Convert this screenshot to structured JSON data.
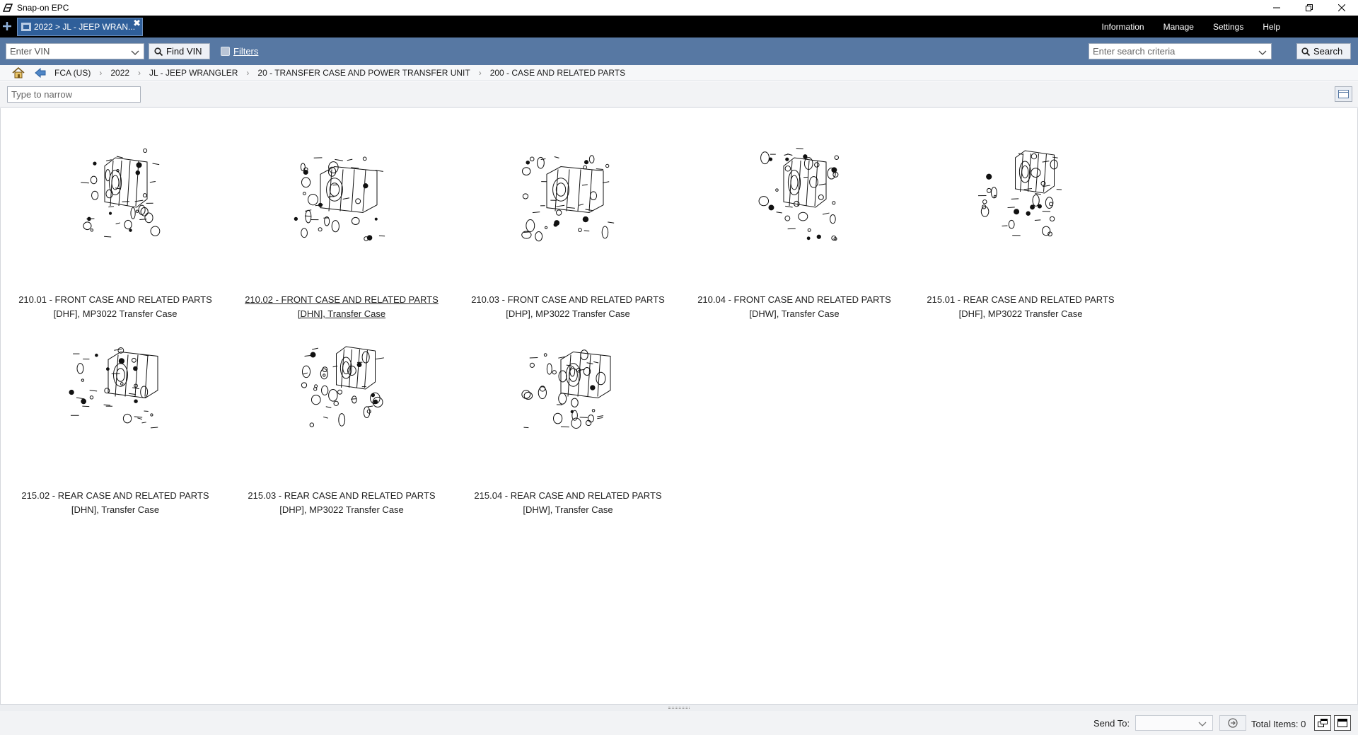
{
  "app": {
    "title": "Snap-on EPC"
  },
  "tabs": [
    {
      "label": "2022 > JL - JEEP WRAN..."
    }
  ],
  "menu": [
    "Information",
    "Manage",
    "Settings",
    "Help"
  ],
  "toolbar": {
    "vin_placeholder": "Enter VIN",
    "find_vin_label": "Find VIN",
    "filters_label": "Filters",
    "search_placeholder": "Enter search criteria",
    "search_label": "Search"
  },
  "breadcrumb": [
    "FCA (US)",
    "2022",
    "JL - JEEP WRANGLER",
    "20 - TRANSFER CASE AND POWER TRANSFER UNIT",
    "200 - CASE AND RELATED PARTS"
  ],
  "narrow": {
    "placeholder": "Type to narrow"
  },
  "items": [
    {
      "title": "210.01 - FRONT CASE AND RELATED PARTS",
      "subtitle": "[DHF], MP3022 Transfer Case",
      "art": "front-a"
    },
    {
      "title": "210.02 - FRONT CASE AND RELATED PARTS",
      "subtitle": "[DHN], Transfer Case",
      "art": "front-b"
    },
    {
      "title": "210.03 - FRONT CASE AND RELATED PARTS",
      "subtitle": "[DHP], MP3022 Transfer Case",
      "art": "front-b"
    },
    {
      "title": "210.04 - FRONT CASE AND RELATED PARTS",
      "subtitle": "[DHW], Transfer Case",
      "art": "front-a"
    },
    {
      "title": "215.01 - REAR CASE AND RELATED PARTS",
      "subtitle": "[DHF], MP3022 Transfer Case",
      "art": "rear-a"
    },
    {
      "title": "215.02 - REAR CASE AND RELATED PARTS",
      "subtitle": "[DHN], Transfer Case",
      "art": "rear-b"
    },
    {
      "title": "215.03 - REAR CASE AND RELATED PARTS",
      "subtitle": "[DHP], MP3022 Transfer Case",
      "art": "rear-a"
    },
    {
      "title": "215.04 - REAR CASE AND RELATED PARTS",
      "subtitle": "[DHW], Transfer Case",
      "art": "rear-b"
    }
  ],
  "status": {
    "send_to_label": "Send To:",
    "total_label": "Total Items: 0"
  },
  "colors": {
    "tabbar": "#000000",
    "toolbar": "#5778a3",
    "active_tab": "#2f5f9a"
  }
}
